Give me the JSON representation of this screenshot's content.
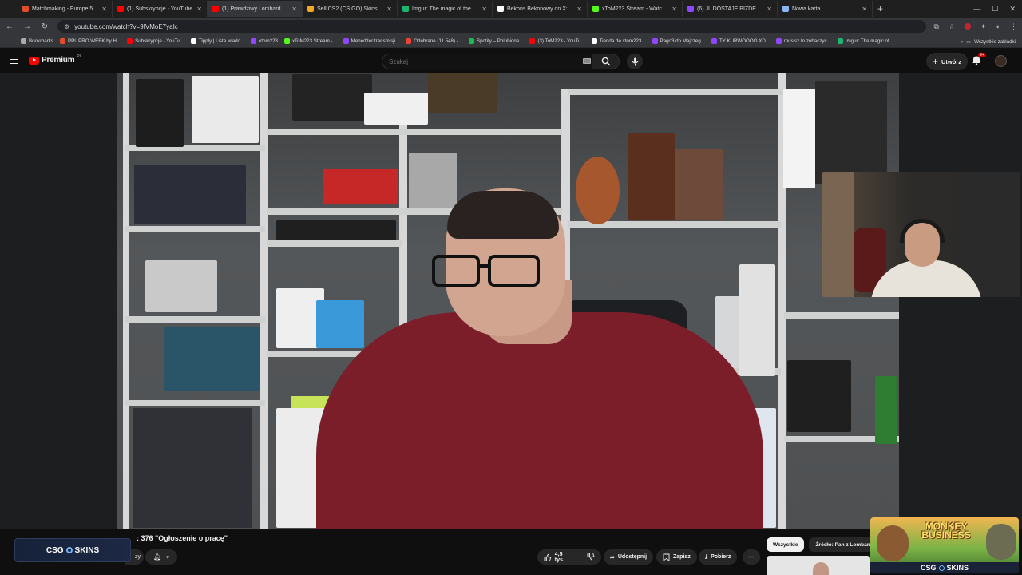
{
  "browser": {
    "tabs": [
      {
        "title": "Matchmaking - Europe 5v5 Qu...",
        "color": "#e44b2b"
      },
      {
        "title": "(1) Subskrypcje - YouTube",
        "color": "#ff0000"
      },
      {
        "title": "(1) Prawdziwy Lombard - G",
        "color": "#ff0000",
        "active": true
      },
      {
        "title": "Sell CS2 (CS:GO) Skins | Best C...",
        "color": "#f5a623"
      },
      {
        "title": "Imgur: The magic of the Intern...",
        "color": "#1bb76e"
      },
      {
        "title": "Bekons Bekonowy on X: \"Karta...",
        "color": "#ffffff"
      },
      {
        "title": "xToM223 Stream - Watch Live o...",
        "color": "#53fc18"
      },
      {
        "title": "(6) JL DOSTAJE PIZDEE - Twitch",
        "color": "#9146ff"
      },
      {
        "title": "Nowa karta",
        "color": "#8ab4f8"
      }
    ],
    "url": "youtube.com/watch?v=9IVMoE7yaIc",
    "bookmarks": [
      {
        "label": "Bookmarks",
        "color": "#aaaaaa"
      },
      {
        "label": "PPL PRO WEEK by H...",
        "color": "#e44b2b"
      },
      {
        "label": "Subskrypcje - YouTu...",
        "color": "#ff0000"
      },
      {
        "label": "Tipply | Lista wiado...",
        "color": "#ffffff"
      },
      {
        "label": "xtom223",
        "color": "#9146ff"
      },
      {
        "label": "xToM223 Stream -...",
        "color": "#53fc18"
      },
      {
        "label": "Menedżer transmisji...",
        "color": "#9146ff"
      },
      {
        "label": "Odebrane (11 548) -...",
        "color": "#ea4335"
      },
      {
        "label": "Spotify – Polubione...",
        "color": "#1db954"
      },
      {
        "label": "(3) ToM223 - YouTu...",
        "color": "#ff0000"
      },
      {
        "label": "Tienda de xtom223...",
        "color": "#ffffff"
      },
      {
        "label": "Pago3 do Majczeg...",
        "color": "#9146ff"
      },
      {
        "label": "TY KURWOOOO XD...",
        "color": "#9146ff"
      },
      {
        "label": "musisz to zobaczyc...",
        "color": "#9146ff"
      },
      {
        "label": "Imgur: The magic of...",
        "color": "#1bb76e"
      }
    ],
    "bookmarks_all": "Wszystkie zakładki"
  },
  "youtube": {
    "logo_text": "Premium",
    "logo_region": "PL",
    "search_placeholder": "Szukaj",
    "create_label": "Utwórz",
    "notif_count": "9+",
    "video_title": ": 376 \"Ogłoszenie o pracę\"",
    "subscribe_partial": "zy",
    "like_count": "4,5 tys.",
    "share_label": "Udostępnij",
    "save_label": "Zapisz",
    "download_label": "Pobierz",
    "chips": [
      "Wszystkie",
      "Źródło: Pan z Lombardu"
    ],
    "overlay_brand": "CSG",
    "overlay_brand2": "SKINS",
    "promo_title": "MONKEY BUSINESS"
  }
}
